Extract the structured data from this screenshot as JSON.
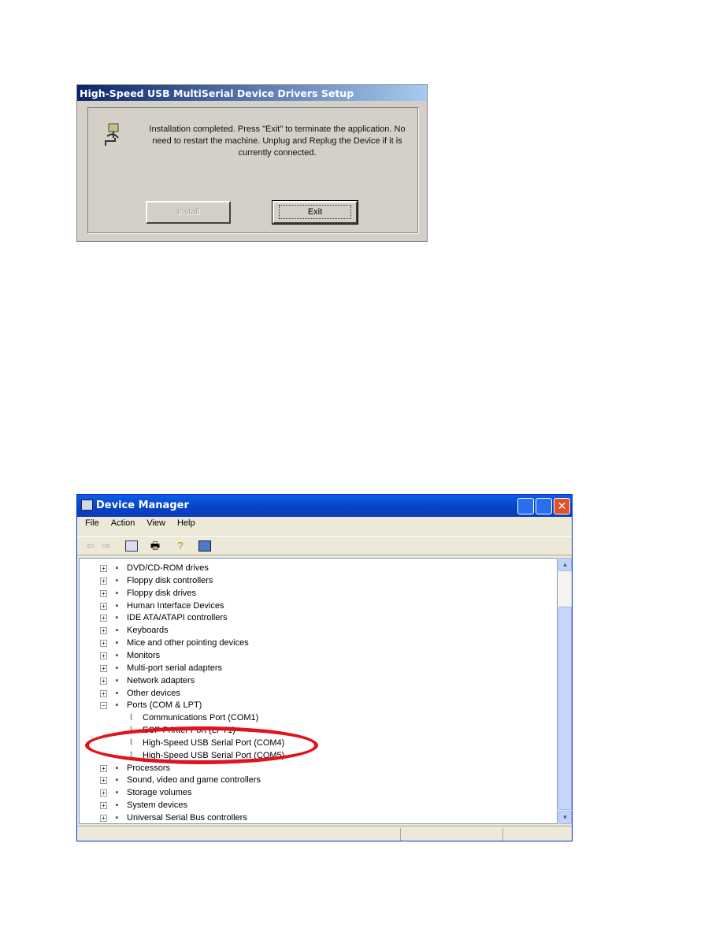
{
  "setup_dialog": {
    "title": "High-Speed USB MultiSerial Device Drivers Setup",
    "message": "Installation completed. Press \"Exit\" to terminate the application. No need to restart the machine. Unplug and Replug the Device if it is currently connected.",
    "install_label": "Install",
    "exit_label": "Exit",
    "icon": "usb-plug-icon"
  },
  "device_manager": {
    "title": "Device Manager",
    "menu": [
      "File",
      "Action",
      "View",
      "Help"
    ],
    "toolbar": [
      "back-icon",
      "forward-icon",
      "show-hide-tree-icon",
      "print-icon",
      "properties-help-icon",
      "scan-hardware-icon"
    ],
    "tree": [
      {
        "label": "DVD/CD-ROM drives",
        "level": 0,
        "expander": "+"
      },
      {
        "label": "Floppy disk controllers",
        "level": 0,
        "expander": "+"
      },
      {
        "label": "Floppy disk drives",
        "level": 0,
        "expander": "+"
      },
      {
        "label": "Human Interface Devices",
        "level": 0,
        "expander": "+"
      },
      {
        "label": "IDE ATA/ATAPI controllers",
        "level": 0,
        "expander": "+"
      },
      {
        "label": "Keyboards",
        "level": 0,
        "expander": "+"
      },
      {
        "label": "Mice and other pointing devices",
        "level": 0,
        "expander": "+"
      },
      {
        "label": "Monitors",
        "level": 0,
        "expander": "+"
      },
      {
        "label": "Multi-port serial adapters",
        "level": 0,
        "expander": "+"
      },
      {
        "label": "Network adapters",
        "level": 0,
        "expander": "+"
      },
      {
        "label": "Other devices",
        "level": 0,
        "expander": "+"
      },
      {
        "label": "Ports (COM & LPT)",
        "level": 0,
        "expander": "-"
      },
      {
        "label": "Communications Port (COM1)",
        "level": 1
      },
      {
        "label": "ECP Printer Port (LPT1)",
        "level": 1
      },
      {
        "label": "High-Speed USB Serial Port (COM4)",
        "level": 1
      },
      {
        "label": "High-Speed USB Serial Port (COM5)",
        "level": 1
      },
      {
        "label": "Processors",
        "level": 0,
        "expander": "+"
      },
      {
        "label": "Sound, video and game controllers",
        "level": 0,
        "expander": "+"
      },
      {
        "label": "Storage volumes",
        "level": 0,
        "expander": "+"
      },
      {
        "label": "System devices",
        "level": 0,
        "expander": "+"
      },
      {
        "label": "Universal Serial Bus controllers",
        "level": 0,
        "expander": "+"
      }
    ],
    "highlight_color": "#e0141c"
  }
}
